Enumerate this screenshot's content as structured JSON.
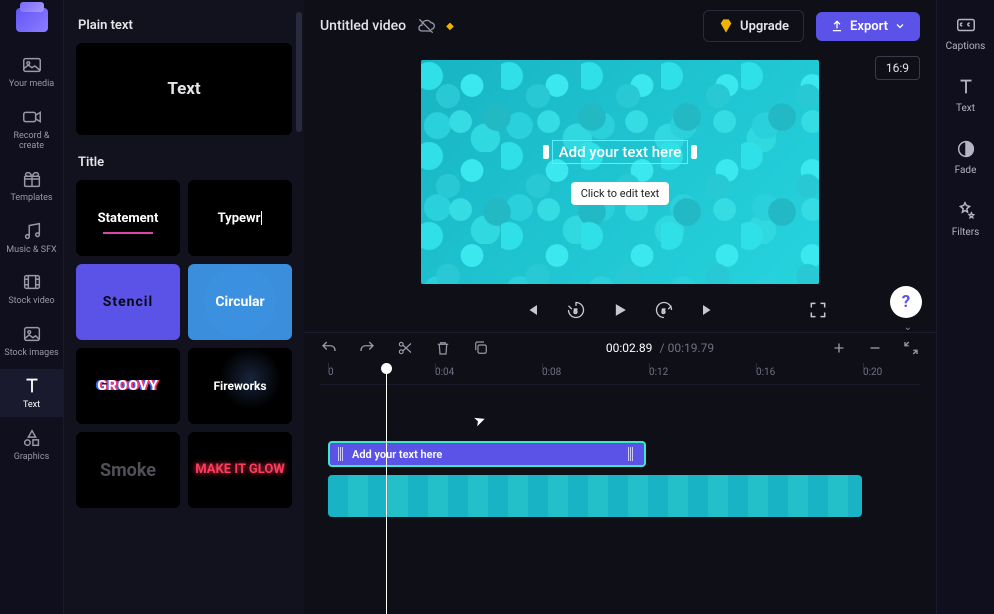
{
  "nav": {
    "items": [
      {
        "label": "Your media"
      },
      {
        "label": "Record & create"
      },
      {
        "label": "Templates"
      },
      {
        "label": "Music & SFX"
      },
      {
        "label": "Stock video"
      },
      {
        "label": "Stock images"
      },
      {
        "label": "Text"
      },
      {
        "label": "Graphics"
      }
    ]
  },
  "sidepanel": {
    "section1_title": "Plain text",
    "plain_text_label": "Text",
    "section2_title": "Title",
    "presets": {
      "statement": "Statement",
      "typewriter": "Typewr",
      "stencil": "Stencil",
      "circular": "Circular",
      "groovy": "GROOVY",
      "fireworks": "Fireworks",
      "smoke": "Smoke",
      "neon": "MAKE IT GLOW"
    }
  },
  "topbar": {
    "title": "Untitled video",
    "upgrade": "Upgrade",
    "export": "Export"
  },
  "preview": {
    "aspect": "16:9",
    "text_overlay": "Add your text here",
    "tooltip": "Click to edit text"
  },
  "timecode": {
    "current": "00:02.89",
    "duration": "00:19.79"
  },
  "ruler": [
    "0",
    "0:04",
    "0:08",
    "0:12",
    "0:16",
    "0:20"
  ],
  "timeline": {
    "text_clip_label": "Add your text here"
  },
  "prop_rail": {
    "items": [
      {
        "label": "Captions"
      },
      {
        "label": "Text"
      },
      {
        "label": "Fade"
      },
      {
        "label": "Filters"
      }
    ]
  },
  "help": "?"
}
